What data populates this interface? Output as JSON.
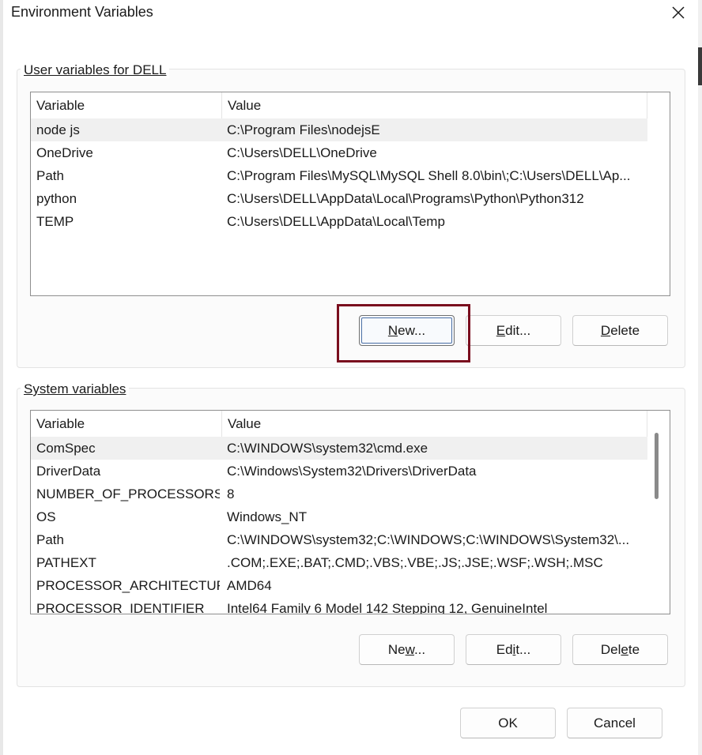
{
  "window": {
    "title": "Environment Variables"
  },
  "user_vars": {
    "label": "User variables for DELL",
    "columns": [
      "Variable",
      "Value"
    ],
    "rows": [
      {
        "name": "node js",
        "value": "C:\\Program Files\\nodejsE",
        "selected": true
      },
      {
        "name": "OneDrive",
        "value": "C:\\Users\\DELL\\OneDrive"
      },
      {
        "name": "Path",
        "value": "C:\\Program Files\\MySQL\\MySQL Shell 8.0\\bin\\;C:\\Users\\DELL\\Ap..."
      },
      {
        "name": "python",
        "value": "C:\\Users\\DELL\\AppData\\Local\\Programs\\Python\\Python312"
      },
      {
        "name": "TEMP",
        "value": "C:\\Users\\DELL\\AppData\\Local\\Temp"
      }
    ],
    "buttons": {
      "new_pre": "",
      "new_key": "N",
      "new_post": "ew...",
      "edit_pre": "",
      "edit_key": "E",
      "edit_post": "dit...",
      "delete_pre": "",
      "delete_key": "D",
      "delete_post": "elete"
    }
  },
  "system_vars": {
    "label": "System variables",
    "columns": [
      "Variable",
      "Value"
    ],
    "rows": [
      {
        "name": "ComSpec",
        "value": "C:\\WINDOWS\\system32\\cmd.exe",
        "selected": true
      },
      {
        "name": "DriverData",
        "value": "C:\\Windows\\System32\\Drivers\\DriverData"
      },
      {
        "name": "NUMBER_OF_PROCESSORS",
        "value": "8"
      },
      {
        "name": "OS",
        "value": "Windows_NT"
      },
      {
        "name": "Path",
        "value": "C:\\WINDOWS\\system32;C:\\WINDOWS;C:\\WINDOWS\\System32\\..."
      },
      {
        "name": "PATHEXT",
        "value": ".COM;.EXE;.BAT;.CMD;.VBS;.VBE;.JS;.JSE;.WSF;.WSH;.MSC"
      },
      {
        "name": "PROCESSOR_ARCHITECTURE",
        "value": "AMD64"
      },
      {
        "name": "PROCESSOR_IDENTIFIER",
        "value": "Intel64 Family 6 Model 142 Stepping 12, GenuineIntel"
      }
    ],
    "buttons": {
      "new_pre": "Ne",
      "new_key": "w",
      "new_post": "...",
      "edit_pre": "Ed",
      "edit_key": "i",
      "edit_post": "t...",
      "delete_pre": "Del",
      "delete_key": "e",
      "delete_post": "te"
    }
  },
  "footer": {
    "ok": "OK",
    "cancel": "Cancel"
  },
  "colors": {
    "highlight": "#7a0e1e",
    "selected_row": "#f0f0f0"
  }
}
